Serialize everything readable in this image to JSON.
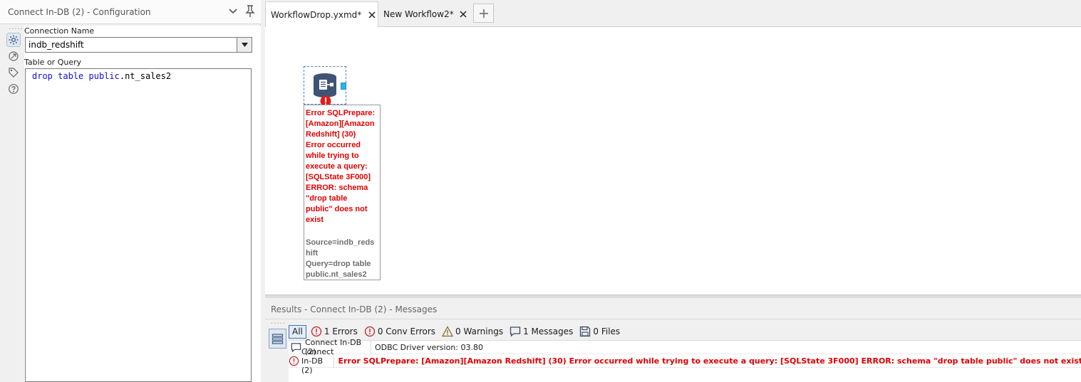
{
  "config_panel": {
    "title": "Connect In-DB (2) - Configuration",
    "connection_name_label": "Connection Name",
    "connection_name_value": "indb_redshift",
    "query_label": "Table or Query",
    "query_keyword_1": "drop",
    "query_keyword_2": "table",
    "query_keyword_3": "public",
    "query_rest": ".nt_sales2"
  },
  "tabs": [
    {
      "label": "WorkflowDrop.yxmd*",
      "active": true
    },
    {
      "label": "New Workflow2*",
      "active": false
    }
  ],
  "canvas": {
    "tool_error_lines": [
      "Error SQLPrepare:",
      "[Amazon][Amazon",
      "Redshift] (30)",
      "Error occurred",
      "while trying to",
      "execute a query:",
      "[SQLState 3F000]",
      "ERROR:  schema",
      "\"drop table",
      "public\" does not",
      "exist"
    ],
    "tool_info_lines": [
      "Source=indb_reds",
      "hift",
      "Query=drop table",
      "public.nt_sales2"
    ]
  },
  "results": {
    "title": "Results - Connect In-DB (2) - Messages",
    "filters": {
      "all": "All",
      "errors": "1 Errors",
      "conv_errors": "0 Conv Errors",
      "warnings": "0 Warnings",
      "messages": "1 Messages",
      "files": "0 Files"
    },
    "rows": [
      {
        "type": "message",
        "tool": "Connect In-DB (2)",
        "message": "ODBC Driver version: 03.80"
      },
      {
        "type": "error",
        "tool": "Connect In-DB (2)",
        "message": "Error SQLPrepare: [Amazon][Amazon Redshift] (30) Error occurred while trying to execute a query: [SQLState 3F000] ERROR:  schema \"drop table public\" does not exist¶"
      }
    ]
  },
  "colors": {
    "error_red": "#e00000",
    "accent_blue": "#3d6fb5",
    "anchor_cyan": "#2db3f0"
  }
}
